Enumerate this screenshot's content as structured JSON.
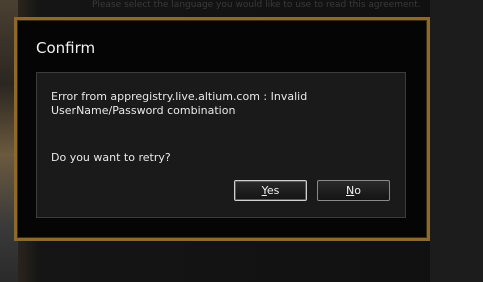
{
  "background": {
    "top_text": "Please select the language you would like to use to read this agreement."
  },
  "dialog": {
    "title": "Confirm",
    "message": "Error from appregistry.live.altium.com : Invalid UserName/Password combination",
    "prompt": "Do you want to retry?",
    "buttons": {
      "yes": {
        "mnemonic": "Y",
        "rest": "es",
        "is_default": true
      },
      "no": {
        "mnemonic": "N",
        "rest": "o",
        "is_default": false
      }
    },
    "border_color": "#8d6a2c"
  }
}
